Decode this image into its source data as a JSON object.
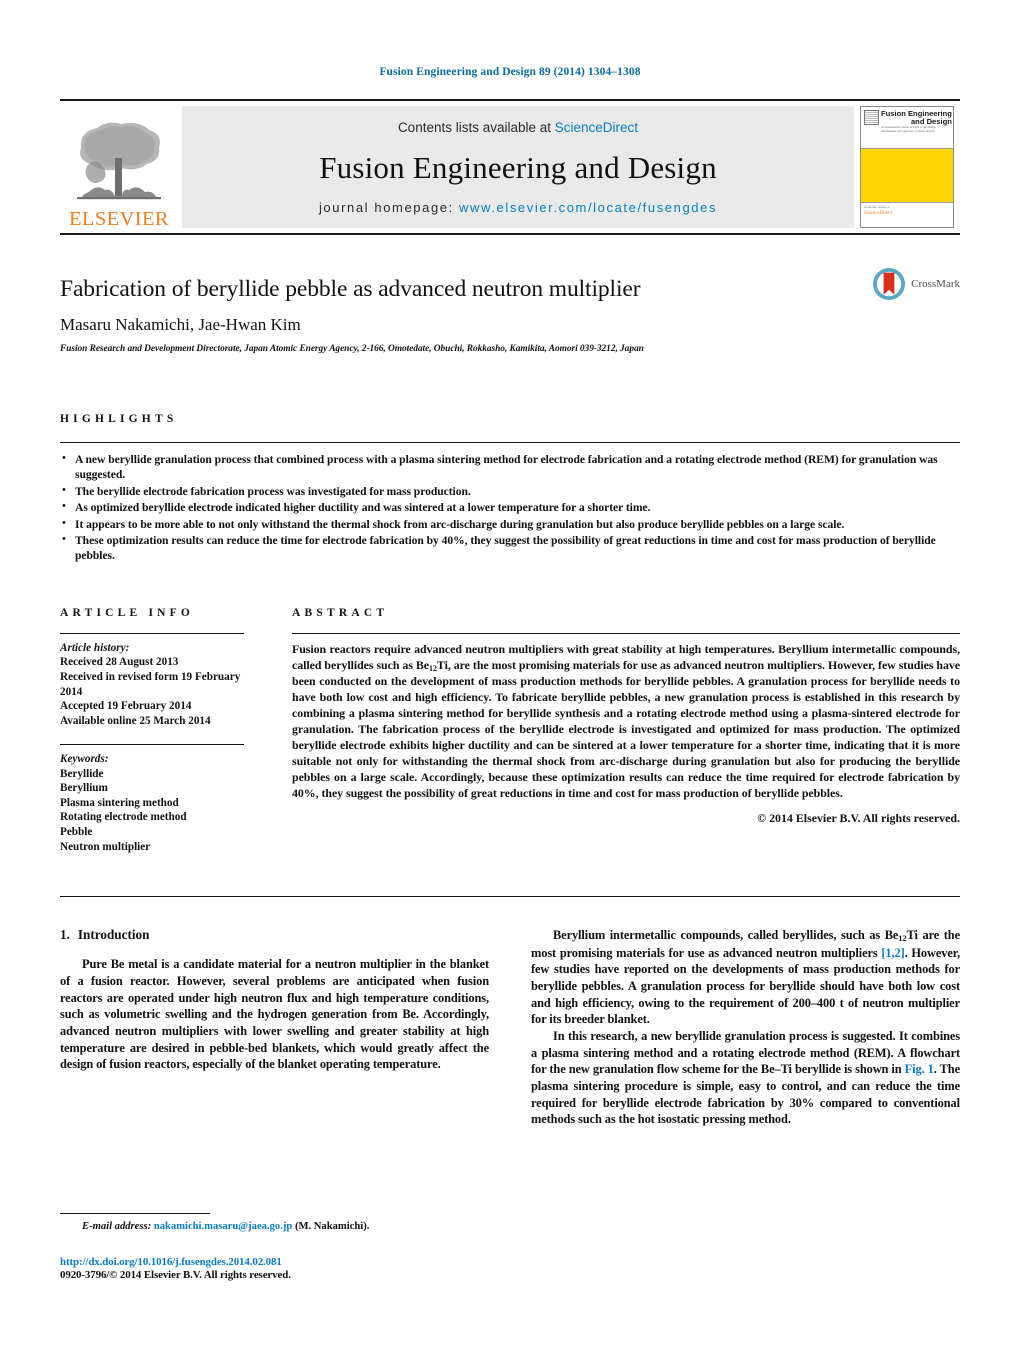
{
  "running_head": "Fusion Engineering and Design 89 (2014) 1304–1308",
  "masthead": {
    "publisher_name": "ELSEVIER",
    "contents_prefix": "Contents lists available at ",
    "contents_link": "ScienceDirect",
    "journal_title": "Fusion Engineering and Design",
    "homepage_prefix": "journal homepage: ",
    "homepage_url": "www.elsevier.com/locate/fusengdes",
    "cover": {
      "line1": "Fusion Engineering",
      "line2": "and Design",
      "small_text": "an international journal devoted to the design, development and operation of fusion devices",
      "footer_text": "Available online at",
      "footer_brand": "ScienceDirect",
      "footer_url": "www.elsevier.com/locate/fusengdes"
    }
  },
  "article": {
    "title": "Fabrication of beryllide pebble as advanced neutron multiplier",
    "authors": "Masaru Nakamichi, Jae-Hwan Kim",
    "affiliation": "Fusion Research and Development Directorate, Japan Atomic Energy Agency, 2-166, Omotedate, Obuchi, Rokkasho, Kamikita, Aomori 039-3212, Japan",
    "crossmark_label": "CrossMark"
  },
  "highlights": {
    "heading": "HIGHLIGHTS",
    "items": [
      "A new beryllide granulation process that combined process with a plasma sintering method for electrode fabrication and a rotating electrode method (REM) for granulation was suggested.",
      "The beryllide electrode fabrication process was investigated for mass production.",
      "As optimized beryllide electrode indicated higher ductility and was sintered at a lower temperature for a shorter time.",
      "It appears to be more able to not only withstand the thermal shock from arc-discharge during granulation but also produce beryllide pebbles on a large scale.",
      "These optimization results can reduce the time for electrode fabrication by 40%, they suggest the possibility of great reductions in time and cost for mass production of beryllide pebbles."
    ]
  },
  "article_info": {
    "heading": "ARTICLE INFO",
    "history_label": "Article history:",
    "history": [
      "Received 28 August 2013",
      "Received in revised form 19 February 2014",
      "Accepted 19 February 2014",
      "Available online 25 March 2014"
    ],
    "keywords_label": "Keywords:",
    "keywords": [
      "Beryllide",
      "Beryllium",
      "Plasma sintering method",
      "Rotating electrode method",
      "Pebble",
      "Neutron multiplier"
    ]
  },
  "abstract": {
    "heading": "ABSTRACT",
    "part1": "Fusion reactors require advanced neutron multipliers with great stability at high temperatures. Beryllium intermetallic compounds, called beryllides such as Be",
    "sub1": "12",
    "part2": "Ti, are the most promising materials for use as advanced neutron multipliers. However, few studies have been conducted on the development of mass production methods for beryllide pebbles. A granulation process for beryllide needs to have both low cost and high efficiency. To fabricate beryllide pebbles, a new granulation process is established in this research by combining a plasma sintering method for beryllide synthesis and a rotating electrode method using a plasma-sintered electrode for granulation. The fabrication process of the beryllide electrode is investigated and optimized for mass production. The optimized beryllide electrode exhibits higher ductility and can be sintered at a lower temperature for a shorter time, indicating that it is more suitable not only for withstanding the thermal shock from arc-discharge during granulation but also for producing the beryllide pebbles on a large scale. Accordingly, because these optimization results can reduce the time required for electrode fabrication by 40%, they suggest the possibility of great reductions in time and cost for mass production of beryllide pebbles.",
    "copyright": "© 2014 Elsevier B.V. All rights reserved."
  },
  "introduction": {
    "number": "1.",
    "title": "Introduction",
    "para1": "Pure Be metal is a candidate material for a neutron multiplier in the blanket of a fusion reactor. However, several problems are anticipated when fusion reactors are operated under high neutron flux and high temperature conditions, such as volumetric swelling and the hydrogen generation from Be. Accordingly, advanced neutron multipliers with lower swelling and greater stability at high temperature are desired in pebble-bed blankets, which would greatly affect the design of fusion reactors, especially of the blanket operating temperature.",
    "para2_a": "Beryllium intermetallic compounds, called beryllides, such as Be",
    "para2_sub": "12",
    "para2_b": "Ti are the most promising materials for use as advanced neutron multipliers ",
    "para2_ref": "[1,2]",
    "para2_c": ". However, few studies have reported on the developments of mass production methods for beryllide pebbles. A granulation process for beryllide should have both low cost and high efficiency, owing to the requirement of 200–400 t of neutron multiplier for its breeder blanket.",
    "para3_a": "In this research, a new beryllide granulation process is suggested. It combines a plasma sintering method and a rotating electrode method (REM). A flowchart for the new granulation flow scheme for the Be–Ti beryllide is shown in ",
    "para3_fig": "Fig. 1",
    "para3_b": ". The plasma sintering procedure is simple, easy to control, and can reduce the time required for beryllide electrode fabrication by 30% compared to conventional methods such as the hot isostatic pressing method."
  },
  "footer": {
    "email_label": "E-mail address:",
    "email": "nakamichi.masaru@jaea.go.jp",
    "email_suffix": "(M. Nakamichi).",
    "doi": "http://dx.doi.org/10.1016/j.fusengdes.2014.02.081",
    "issn": "0920-3796/© 2014 Elsevier B.V. All rights reserved."
  },
  "colors": {
    "link": "#0b7bc0",
    "running_head": "#0b6a9e",
    "elsevier_orange": "#ef7d22",
    "banner_gray": "#e9e9e9",
    "cover_yellow": "#ffd400",
    "crossmark_red": "#d7301f",
    "crossmark_blue": "#5aa7c4"
  }
}
